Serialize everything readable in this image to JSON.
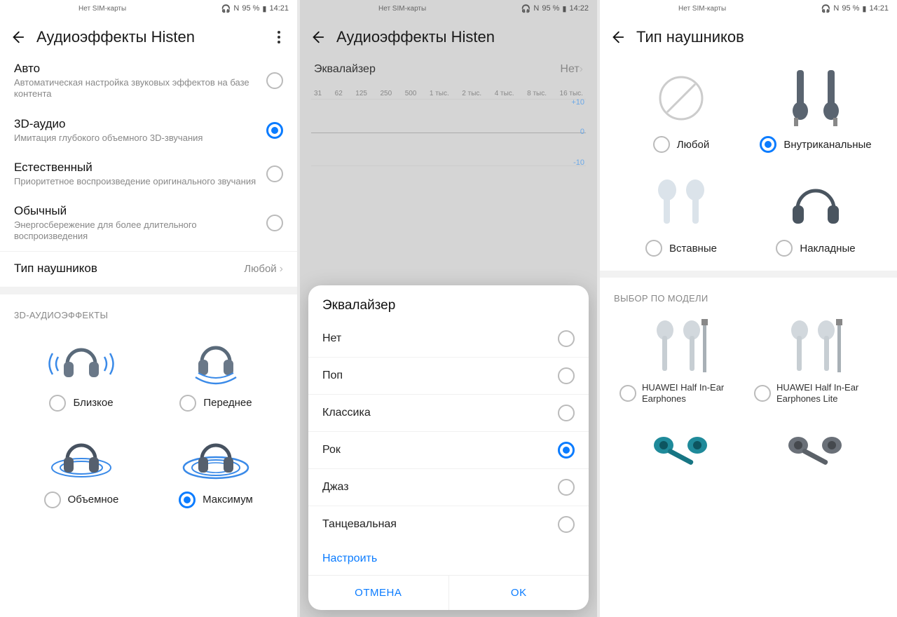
{
  "status": {
    "sim": "Нет SIM-карты",
    "nfc": "N",
    "battery": "95 %",
    "t1": "14:21",
    "t2": "14:22"
  },
  "screen1": {
    "title": "Аудиоэффекты Histen",
    "modes": [
      {
        "title": "Авто",
        "sub": "Автоматическая настройка звуковых эффектов на базе контента",
        "sel": false
      },
      {
        "title": "3D-аудио",
        "sub": "Имитация глубокого объемного 3D-звучания",
        "sel": true
      },
      {
        "title": "Естественный",
        "sub": "Приоритетное воспроизведение оригинального звучания",
        "sel": false
      },
      {
        "title": "Обычный",
        "sub": "Энергосбережение для более длительного воспроизведения",
        "sel": false
      }
    ],
    "hp_row": {
      "label": "Тип наушников",
      "value": "Любой"
    },
    "fx_label": "3D-АУДИОЭФФЕКТЫ",
    "fx": [
      {
        "label": "Близкое",
        "sel": false
      },
      {
        "label": "Переднее",
        "sel": false
      },
      {
        "label": "Объемное",
        "sel": false
      },
      {
        "label": "Максимум",
        "sel": true
      }
    ]
  },
  "screen2": {
    "title": "Аудиоэффекты Histen",
    "eq_label": "Эквалайзер",
    "eq_value": "Нет",
    "freqs": [
      "31",
      "62",
      "125",
      "250",
      "500",
      "1 тыс.",
      "2 тыс.",
      "4 тыс.",
      "8 тыс.",
      "16 тыс."
    ],
    "scale": {
      "hi": "+10",
      "mid": "0",
      "lo": "-10"
    },
    "dialog": {
      "title": "Эквалайзер",
      "opts": [
        {
          "t": "Нет",
          "sel": false
        },
        {
          "t": "Поп",
          "sel": false
        },
        {
          "t": "Классика",
          "sel": false
        },
        {
          "t": "Рок",
          "sel": true
        },
        {
          "t": "Джаз",
          "sel": false
        },
        {
          "t": "Танцевальная",
          "sel": false
        }
      ],
      "customize": "Настроить",
      "cancel": "ОТМЕНА",
      "ok": "OK"
    }
  },
  "screen3": {
    "title": "Тип наушников",
    "types": [
      {
        "label": "Любой",
        "sel": false
      },
      {
        "label": "Внутриканальные",
        "sel": true
      },
      {
        "label": "Вставные",
        "sel": false
      },
      {
        "label": "Накладные",
        "sel": false
      }
    ],
    "model_label": "ВЫБОР ПО МОДЕЛИ",
    "models": [
      {
        "label": "HUAWEI Half In-Ear Earphones",
        "sel": false
      },
      {
        "label": "HUAWEI Half In-Ear Earphones Lite",
        "sel": false
      }
    ]
  }
}
